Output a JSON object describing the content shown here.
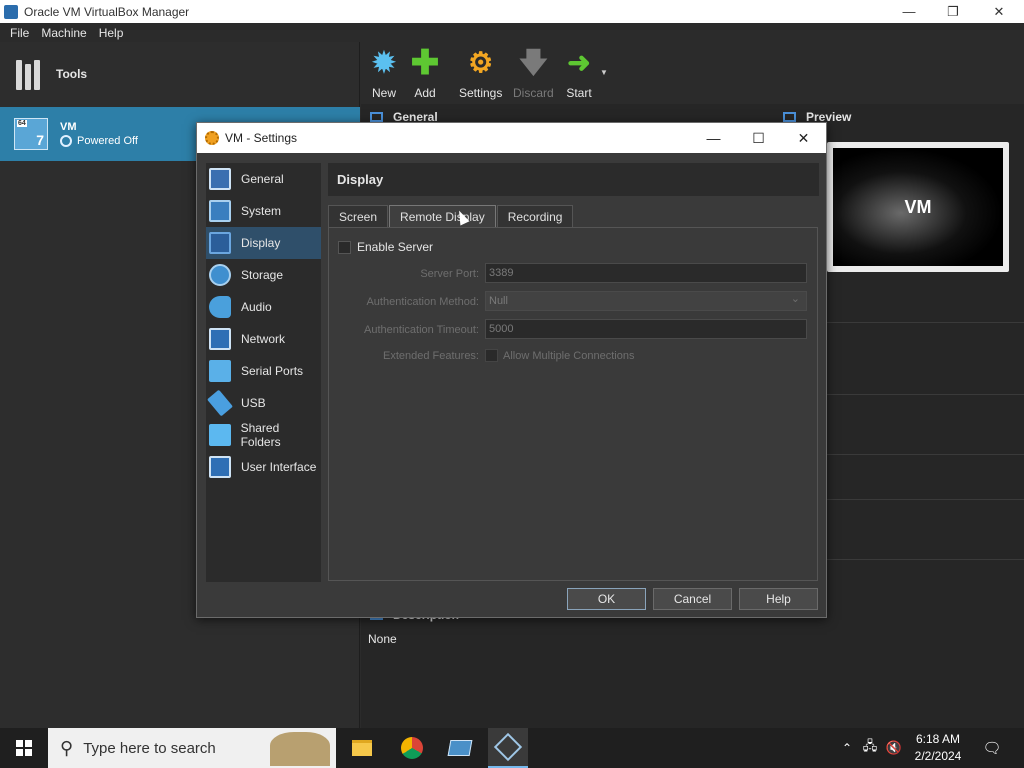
{
  "window": {
    "title": "Oracle VM VirtualBox Manager",
    "minimize_icon": "minimize-icon",
    "restore_icon": "restore-icon",
    "close_icon": "close-icon"
  },
  "menu": [
    {
      "label": "File",
      "mnemonic": "F"
    },
    {
      "label": "Machine",
      "mnemonic": "M"
    },
    {
      "label": "Help",
      "mnemonic": "H"
    }
  ],
  "sidebar": {
    "tools_label": "Tools",
    "vm": {
      "name": "VM",
      "status": "Powered Off",
      "os_badge": "64",
      "os_version": "7"
    }
  },
  "toolbar": {
    "new": "New",
    "add": "Add",
    "settings": "Settings",
    "discard": "Discard",
    "start": "Start"
  },
  "details": {
    "general_header": "General",
    "preview_header": "Preview",
    "preview_vm_name": "VM",
    "description_header": "Description",
    "description_text": "None"
  },
  "dialog": {
    "title": "VM - Settings",
    "nav_items": [
      {
        "label": "General",
        "icon": "general-icon"
      },
      {
        "label": "System",
        "icon": "system-icon"
      },
      {
        "label": "Display",
        "icon": "display-icon",
        "selected": true
      },
      {
        "label": "Storage",
        "icon": "storage-icon"
      },
      {
        "label": "Audio",
        "icon": "audio-icon"
      },
      {
        "label": "Network",
        "icon": "network-icon"
      },
      {
        "label": "Serial Ports",
        "icon": "serial-ports-icon"
      },
      {
        "label": "USB",
        "icon": "usb-icon"
      },
      {
        "label": "Shared Folders",
        "icon": "shared-folders-icon"
      },
      {
        "label": "User Interface",
        "icon": "user-interface-icon"
      }
    ],
    "page_title": "Display",
    "tabs": [
      {
        "label": "Screen"
      },
      {
        "label": "Remote Display",
        "active": true
      },
      {
        "label": "Recording"
      }
    ],
    "remote_display": {
      "enable_server_label": "Enable Server",
      "enable_server_checked": false,
      "server_port_label": "Server Port:",
      "server_port_value": "3389",
      "auth_method_label": "Authentication Method:",
      "auth_method_value": "Null",
      "auth_timeout_label": "Authentication Timeout:",
      "auth_timeout_value": "5000",
      "extended_features_label": "Extended Features:",
      "allow_multiple_label": "Allow Multiple Connections",
      "allow_multiple_checked": false
    },
    "buttons": {
      "ok": "OK",
      "cancel": "Cancel",
      "help": "Help"
    }
  },
  "taskbar": {
    "search_placeholder": "Type here to search",
    "time": "6:18 AM",
    "date": "2/2/2024"
  },
  "colors": {
    "accent": "#2d7fa8",
    "selection": "#2f4f6a",
    "window_bg": "#2b2b2b"
  }
}
